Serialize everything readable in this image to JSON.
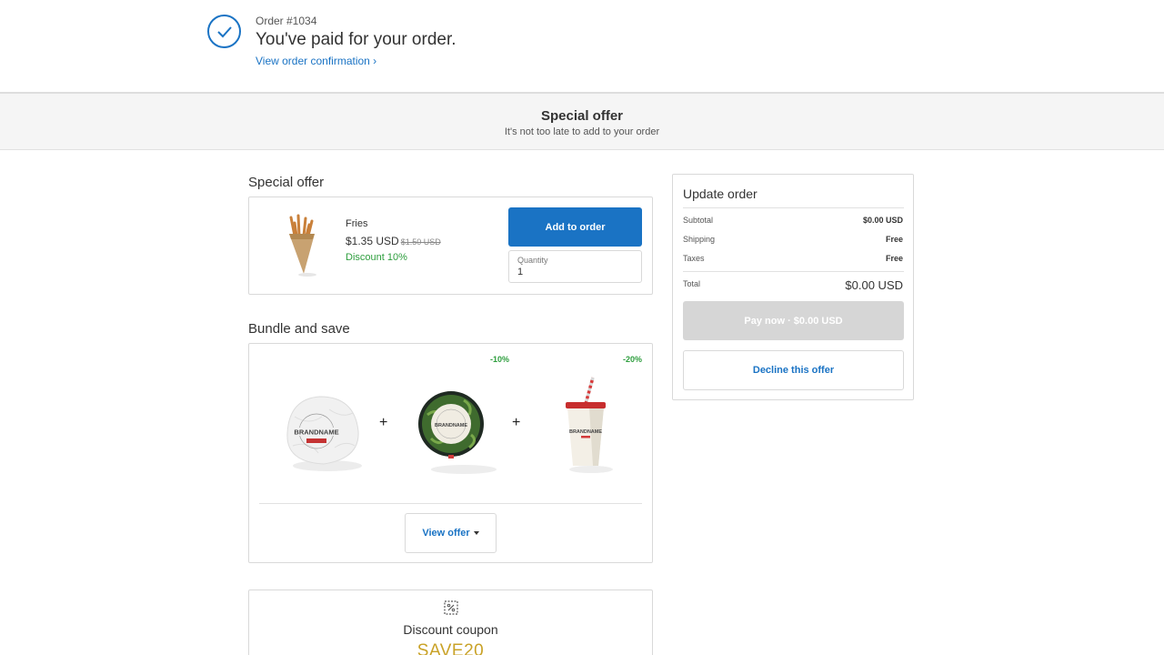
{
  "header": {
    "order_number": "Order #1034",
    "title": "You've paid for your order.",
    "view_confirmation": "View order confirmation ›"
  },
  "banner": {
    "title": "Special offer",
    "subtitle": "It's not too late to add to your order"
  },
  "special_offer": {
    "section_title": "Special offer",
    "product": {
      "name": "Fries",
      "price": "$1.35 USD",
      "original_price": "$1.50 USD",
      "discount": "Discount 10%"
    },
    "add_button": "Add to order",
    "quantity_label": "Quantity",
    "quantity_value": "1"
  },
  "bundle": {
    "section_title": "Bundle and save",
    "items": [
      {
        "icon": "burger-image",
        "badge": ""
      },
      {
        "icon": "salad-bowl-image",
        "badge": "-10%"
      },
      {
        "icon": "drink-cup-image",
        "badge": "-20%"
      }
    ],
    "brand_text": "BRANDNAME",
    "view_offer": "View offer"
  },
  "coupon": {
    "icon": "coupon-icon",
    "title": "Discount coupon",
    "code": "SAVE20"
  },
  "update_order": {
    "title": "Update order",
    "rows": [
      {
        "label": "Subtotal",
        "value": "$0.00 USD"
      },
      {
        "label": "Shipping",
        "value": "Free"
      },
      {
        "label": "Taxes",
        "value": "Free"
      }
    ],
    "total_label": "Total",
    "total_value": "$0.00 USD",
    "pay_button": "Pay now · $0.00 USD",
    "decline_button": "Decline this offer"
  },
  "colors": {
    "accent": "#1a73c4",
    "discount_green": "#2e9e3e",
    "coupon_gold": "#c9a227",
    "disabled": "#d6d6d6"
  }
}
